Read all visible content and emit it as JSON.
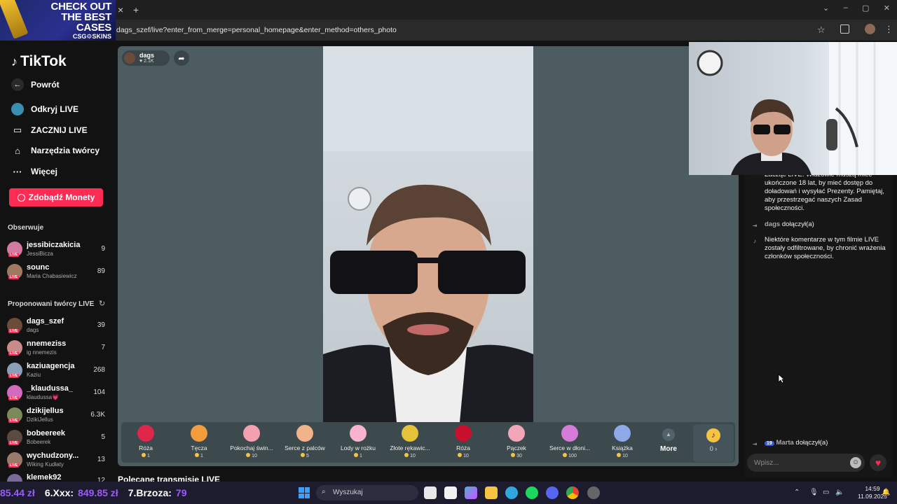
{
  "browser": {
    "ad_line1": "CHECK OUT",
    "ad_line2": "THE BEST",
    "ad_line3": "CASES",
    "ad_brand": "CSG⚙SKINS",
    "tab_close": "×",
    "new_tab": "+",
    "url": "dags_szef/live?enter_from_merge=personal_homepage&enter_method=others_photo"
  },
  "sidebar": {
    "logo": "TikTok",
    "nav": [
      {
        "label": "Powrót",
        "icon": "←"
      },
      {
        "label": "Odkryj LIVE",
        "icon": ""
      },
      {
        "label": "ZACZNIJ LIVE",
        "icon": "▭"
      },
      {
        "label": "Narzędzia twórcy",
        "icon": "⌂"
      },
      {
        "label": "Więcej",
        "icon": "···"
      }
    ],
    "coins_button": "Zdobądź Monety",
    "following_title": "Obserwuje",
    "following": [
      {
        "name": "jessibiczakicia",
        "sub": "JessiBicza",
        "count": "9"
      },
      {
        "name": "sounc",
        "sub": "Maria Chabasiewicz",
        "count": "89"
      }
    ],
    "suggested_title": "Proponowani twórcy LIVE",
    "live_badge": "LIVE",
    "suggested": [
      {
        "name": "dags_szef",
        "sub": "dags",
        "count": "39"
      },
      {
        "name": "nnemeziss",
        "sub": "ig nnemezis",
        "count": "7"
      },
      {
        "name": "kaziuagencja",
        "sub": "Kaziu",
        "count": "268"
      },
      {
        "name": "_klaudussa_",
        "sub": "klaudussa💗",
        "count": "104"
      },
      {
        "name": "dzikijellus",
        "sub": "DzikiJellus",
        "count": "6.3K"
      },
      {
        "name": "bobeereek",
        "sub": "Bobeerek",
        "count": "5"
      },
      {
        "name": "wychudzony...",
        "sub": "Wiking Kudłaty",
        "count": "13"
      },
      {
        "name": "klemek92",
        "sub": "",
        "count": "12"
      }
    ]
  },
  "stream": {
    "host_name": "dags",
    "host_likes": "♥ 2.1K",
    "recommended": "Polecane transmisje LIVE"
  },
  "gifts": [
    {
      "name": "Róża",
      "price": "1",
      "color": "#e0264a"
    },
    {
      "name": "Tęcza",
      "price": "1",
      "color": "#f39c3c"
    },
    {
      "name": "Pokochaj świn...",
      "price": "10",
      "color": "#f4a0b0"
    },
    {
      "name": "Serce z palców",
      "price": "5",
      "color": "#f1b48a"
    },
    {
      "name": "Lody w rożku",
      "price": "1",
      "color": "#f7b3cf"
    },
    {
      "name": "Złote rękawic...",
      "price": "10",
      "color": "#e6c23a"
    },
    {
      "name": "Róża",
      "price": "10",
      "color": "#c8102e"
    },
    {
      "name": "Pączek",
      "price": "30",
      "color": "#f2a6b7"
    },
    {
      "name": "Serce w dłoni...",
      "price": "100",
      "color": "#d57bd8"
    },
    {
      "name": "Książka",
      "price": "10",
      "color": "#8fa8e8"
    }
  ],
  "more_label": "More",
  "coins_value": "0 ›",
  "chat": {
    "system_text": "Zacząć LIVE. Widzowie muszą mieć ukończone 18 lat, by mieć dostęp do doładowań i wysyłać Prezenty. Pamiętaj, aby przestrzegać naszych Zasad społeczności.",
    "join1_user": "dags",
    "join_text": "dołączył(a)",
    "filter_text": "Niektóre komentarze w tym filmie LIVE zostały odfiltrowane, by chronić wrażenia członków społeczności.",
    "join2_level": "19",
    "join2_user": "Marta",
    "input_placeholder": "Wpisz..."
  },
  "taskbar": {
    "ticker": [
      {
        "text": "85.44 zł",
        "color": "#9b5cf6"
      },
      {
        "text": "6.Xxx:",
        "color": "#ffffff"
      },
      {
        "text": "849.85 zł",
        "color": "#9b5cf6"
      },
      {
        "text": "7.Brzoza:",
        "color": "#ffffff"
      },
      {
        "text": "79",
        "color": "#9b5cf6"
      }
    ],
    "search": "Wyszukaj",
    "time": "14:59",
    "date": "11.09.2025"
  }
}
